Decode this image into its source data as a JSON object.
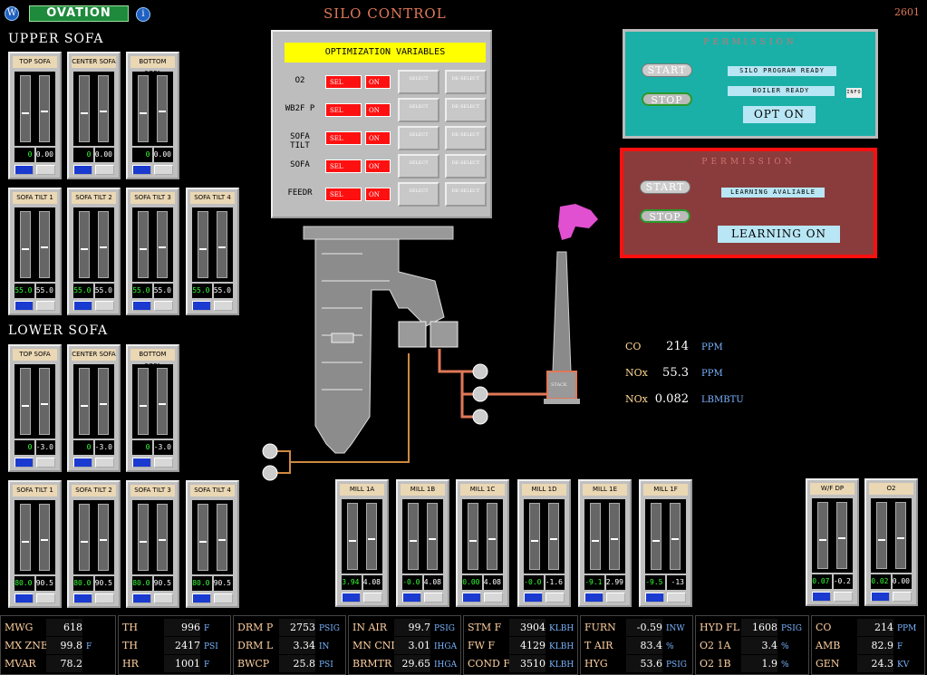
{
  "header": {
    "logo": "OVATION",
    "title": "SILO CONTROL",
    "screen_num": "2601",
    "info_icon": "i"
  },
  "sections": {
    "upper": "UPPER SOFA",
    "lower": "LOWER SOFA"
  },
  "gauges": {
    "upper_top": [
      {
        "title": "TOP SOFA",
        "v1": "0",
        "v2": "0.00"
      },
      {
        "title": "CENTER SOFA",
        "v1": "0",
        "v2": "0.00"
      },
      {
        "title": "BOTTOM SOFA",
        "v1": "0",
        "v2": "0.00"
      }
    ],
    "upper_tilt": [
      {
        "title": "SOFA TILT 1",
        "v1": "55.0",
        "v2": "55.0"
      },
      {
        "title": "SOFA TILT 2",
        "v1": "55.0",
        "v2": "55.0"
      },
      {
        "title": "SOFA TILT 3",
        "v1": "55.0",
        "v2": "55.0"
      },
      {
        "title": "SOFA TILT 4",
        "v1": "55.0",
        "v2": "55.0"
      }
    ],
    "lower_top": [
      {
        "title": "TOP SOFA",
        "v1": "0",
        "v2": "-3.0"
      },
      {
        "title": "CENTER SOFA",
        "v1": "0",
        "v2": "-3.0"
      },
      {
        "title": "BOTTOM SOFA",
        "v1": "0",
        "v2": "-3.0"
      }
    ],
    "lower_tilt": [
      {
        "title": "SOFA TILT 1",
        "v1": "80.0",
        "v2": "90.5"
      },
      {
        "title": "SOFA TILT 2",
        "v1": "80.0",
        "v2": "90.5"
      },
      {
        "title": "SOFA TILT 3",
        "v1": "80.0",
        "v2": "90.5"
      },
      {
        "title": "SOFA TILT 4",
        "v1": "80.0",
        "v2": "90.5"
      }
    ],
    "mills": [
      {
        "title": "MILL 1A",
        "v1": "3.94",
        "v2": "4.08"
      },
      {
        "title": "MILL 1B",
        "v1": "-0.0",
        "v2": "4.08"
      },
      {
        "title": "MILL 1C",
        "v1": "0.00",
        "v2": "4.08"
      },
      {
        "title": "MILL 1D",
        "v1": "-0.0",
        "v2": "-1.6"
      },
      {
        "title": "MILL 1E",
        "v1": "-9.1",
        "v2": "2.99"
      },
      {
        "title": "MILL 1F",
        "v1": "-9.5",
        "v2": "-13"
      }
    ],
    "right": [
      {
        "title": "W/F DP",
        "v1": "0.07",
        "v2": "-0.2"
      },
      {
        "title": "O2",
        "v1": "0.02",
        "v2": "0.00"
      }
    ]
  },
  "optimization": {
    "title": "OPTIMIZATION VARIABLES",
    "sel": "SEL",
    "on": "ON",
    "select": "SELECT",
    "deselect": "DE-SELECT",
    "rows": [
      "O2",
      "WB2F P",
      "SOFA TILT",
      "SOFA",
      "FEEDR"
    ]
  },
  "permission1": {
    "title": "PERMISSION",
    "start": "START",
    "stop": "STOP",
    "silo": "SILO PROGRAM READY",
    "boiler": "BOILER READY",
    "info": "INFO",
    "opt_on": "OPT ON"
  },
  "permission2": {
    "title": "PERMISSION",
    "start": "START",
    "stop": "STOP",
    "learning_avail": "LEARNING AVALIABLE",
    "learning_on": "LEARNING ON"
  },
  "stack_label": "STACK",
  "emissions": [
    {
      "k": "CO",
      "v": "214",
      "u": "PPM"
    },
    {
      "k": "NOx",
      "v": "55.3",
      "u": "PPM"
    },
    {
      "k": "NOx",
      "v": "0.082",
      "u": "LBMBTU"
    }
  ],
  "bottom": [
    [
      {
        "l": "MWG",
        "v": "618",
        "u": ""
      },
      {
        "l": "MX ZNE",
        "v": "99.8",
        "u": "F"
      },
      {
        "l": "MVAR",
        "v": "78.2",
        "u": ""
      }
    ],
    [
      {
        "l": "TH",
        "v": "996",
        "u": "F"
      },
      {
        "l": "TH",
        "v": "2417",
        "u": "PSI"
      },
      {
        "l": "HR",
        "v": "1001",
        "u": "F"
      }
    ],
    [
      {
        "l": "DRM P",
        "v": "2753",
        "u": "PSIG"
      },
      {
        "l": "DRM L",
        "v": "3.34",
        "u": "IN"
      },
      {
        "l": "BWCP",
        "v": "25.8",
        "u": "PSI"
      }
    ],
    [
      {
        "l": "IN AIR",
        "v": "99.7",
        "u": "PSIG"
      },
      {
        "l": "MN CND",
        "v": "3.01",
        "u": "IHGA"
      },
      {
        "l": "BRMTR",
        "v": "29.65",
        "u": "IHGA"
      }
    ],
    [
      {
        "l": "STM F",
        "v": "3904",
        "u": "KLBH"
      },
      {
        "l": "FW F",
        "v": "4129",
        "u": "KLBH"
      },
      {
        "l": "COND F",
        "v": "3510",
        "u": "KLBH"
      }
    ],
    [
      {
        "l": "FURN",
        "v": "-0.59",
        "u": "INW"
      },
      {
        "l": "T AIR",
        "v": "83.4",
        "u": "%"
      },
      {
        "l": "HYG",
        "v": "53.6",
        "u": "PSIG"
      }
    ],
    [
      {
        "l": "HYD FL",
        "v": "1608",
        "u": "PSIG"
      },
      {
        "l": "O2 1A",
        "v": "3.4",
        "u": "%"
      },
      {
        "l": "O2 1B",
        "v": "1.9",
        "u": "%"
      }
    ],
    [
      {
        "l": "CO",
        "v": "214",
        "u": "PPM"
      },
      {
        "l": "AMB",
        "v": "82.9",
        "u": "F"
      },
      {
        "l": "GEN",
        "v": "24.3",
        "u": "KV"
      }
    ]
  ]
}
